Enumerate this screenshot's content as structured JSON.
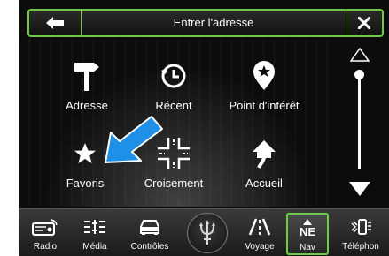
{
  "header": {
    "title": "Entrer l'adresse"
  },
  "menu": [
    {
      "label": "Adresse",
      "icon": "signpost-icon"
    },
    {
      "label": "Récent",
      "icon": "recent-clock-icon"
    },
    {
      "label": "Point d'intérêt",
      "icon": "poi-pin-icon"
    },
    {
      "label": "Favoris",
      "icon": "star-icon"
    },
    {
      "label": "Croisement",
      "icon": "intersection-icon"
    },
    {
      "label": "Accueil",
      "icon": "home-arrow-icon"
    }
  ],
  "bottom_bar": {
    "items": [
      {
        "label": "Radio",
        "icon": "radio-icon"
      },
      {
        "label": "Média",
        "icon": "media-icon"
      },
      {
        "label": "Contrôles",
        "icon": "car-icon"
      },
      {
        "label": "Voyage",
        "icon": "road-icon"
      },
      {
        "label": "Nav",
        "icon": "compass-icon",
        "heading": "NE"
      },
      {
        "label": "Téléphon",
        "icon": "phone-icon"
      }
    ]
  },
  "colors": {
    "accent": "#6ecb46",
    "callout_arrow": "#1e90e8",
    "background": "#0c0c0c"
  }
}
